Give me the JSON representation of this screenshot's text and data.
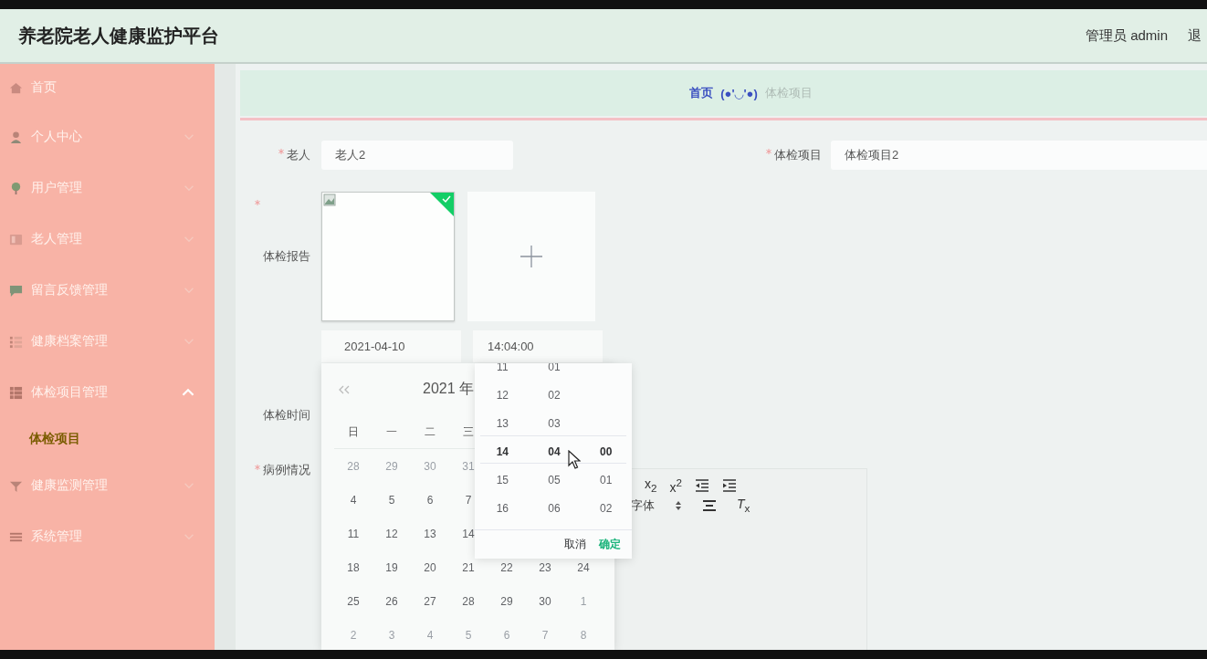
{
  "header": {
    "title": "养老院老人健康监护平台",
    "user": "管理员 admin",
    "logout": "退"
  },
  "sidebar": {
    "items": [
      {
        "label": "首页"
      },
      {
        "label": "个人中心",
        "expanded": false
      },
      {
        "label": "用户管理",
        "expanded": false
      },
      {
        "label": "老人管理",
        "expanded": false
      },
      {
        "label": "留言反馈管理",
        "expanded": false
      },
      {
        "label": "健康档案管理",
        "expanded": false
      },
      {
        "label": "体检项目管理",
        "expanded": true,
        "children": [
          {
            "label": "体检项目",
            "selected": true
          }
        ]
      },
      {
        "label": "健康监测管理",
        "expanded": false
      },
      {
        "label": "系统管理",
        "expanded": false
      }
    ]
  },
  "breadcrumb": {
    "home": "首页",
    "separator": "(●'◡'●)",
    "current": "体检项目"
  },
  "form": {
    "rows": [
      {
        "fields": [
          {
            "kind": "select",
            "label": "老人",
            "required": true,
            "value": "老人2"
          },
          {
            "kind": "select",
            "label": "体检项目",
            "required": true,
            "value": "体检项目2"
          }
        ]
      },
      {
        "fields": [
          {
            "kind": "upload",
            "label": "体检报告",
            "required": true,
            "files": [
              {
                "uploaded": true
              }
            ]
          }
        ]
      },
      {
        "fields": [
          {
            "kind": "datetime",
            "label": "体检时间",
            "required": false,
            "date": "2021-04-10",
            "time": "14:04:00"
          }
        ]
      },
      {
        "fields": [
          {
            "kind": "editor",
            "label": "病例情况",
            "required": true,
            "toolbar_rows": [
              [
                {
                  "kind": "text",
                  "text": "x$_{2}$"
                },
                {
                  "kind": "text",
                  "text": "x$^{2}$"
                },
                {
                  "kind": "outdent"
                },
                {
                  "kind": "indent"
                }
              ],
              [
                {
                  "kind": "select",
                  "text": "字体"
                },
                {
                  "kind": "align"
                },
                {
                  "kind": "text",
                  "text": "*T*$_{x}$"
                }
              ]
            ]
          }
        ]
      }
    ]
  },
  "date_picker": {
    "title": "2021 年",
    "weekdays": [
      "日",
      "一",
      "二",
      "三"
    ],
    "weeks": [
      [
        {
          "day": "28",
          "muted": true
        },
        {
          "day": "29",
          "muted": true
        },
        {
          "day": "30",
          "muted": true
        },
        {
          "day": "31",
          "muted": true
        }
      ],
      [
        {
          "day": "4",
          "muted": false
        },
        {
          "day": "5",
          "muted": false
        },
        {
          "day": "6",
          "muted": false
        },
        {
          "day": "7",
          "muted": false
        }
      ],
      [
        {
          "day": "11",
          "muted": false
        },
        {
          "day": "12",
          "muted": false
        },
        {
          "day": "13",
          "muted": false
        },
        {
          "day": "14",
          "muted": false
        }
      ],
      [
        {
          "day": "18",
          "muted": false
        },
        {
          "day": "19",
          "muted": false
        },
        {
          "day": "20",
          "muted": false
        },
        {
          "day": "21",
          "muted": false
        },
        {
          "day": "22",
          "muted": false
        },
        {
          "day": "23",
          "muted": false
        },
        {
          "day": "24",
          "muted": false
        }
      ],
      [
        {
          "day": "25",
          "muted": false
        },
        {
          "day": "26",
          "muted": false
        },
        {
          "day": "27",
          "muted": false
        },
        {
          "day": "28",
          "muted": false
        },
        {
          "day": "29",
          "muted": false
        },
        {
          "day": "30",
          "muted": false
        },
        {
          "day": "1",
          "muted": true
        }
      ],
      [
        {
          "day": "2",
          "muted": true
        },
        {
          "day": "3",
          "muted": true
        },
        {
          "day": "4",
          "muted": true
        },
        {
          "day": "5",
          "muted": true
        },
        {
          "day": "6",
          "muted": true
        },
        {
          "day": "7",
          "muted": true
        },
        {
          "day": "8",
          "muted": true
        }
      ]
    ]
  },
  "time_picker": {
    "columns": [
      {
        "items": [
          {
            "text": "11",
            "selected": false
          },
          {
            "text": "12",
            "selected": false
          },
          {
            "text": "13",
            "selected": false
          },
          {
            "text": "14",
            "selected": true
          },
          {
            "text": "15",
            "selected": false
          },
          {
            "text": "16",
            "selected": false
          }
        ]
      },
      {
        "items": [
          {
            "text": "01",
            "selected": false
          },
          {
            "text": "02",
            "selected": false
          },
          {
            "text": "03",
            "selected": false
          },
          {
            "text": "04",
            "selected": true
          },
          {
            "text": "05",
            "selected": false
          },
          {
            "text": "06",
            "selected": false
          }
        ]
      },
      {
        "items": [
          {
            "text": "00",
            "selected": true
          },
          {
            "text": "01",
            "selected": false
          },
          {
            "text": "02",
            "selected": false
          }
        ]
      }
    ],
    "cancel": "取消",
    "confirm": "确定"
  }
}
